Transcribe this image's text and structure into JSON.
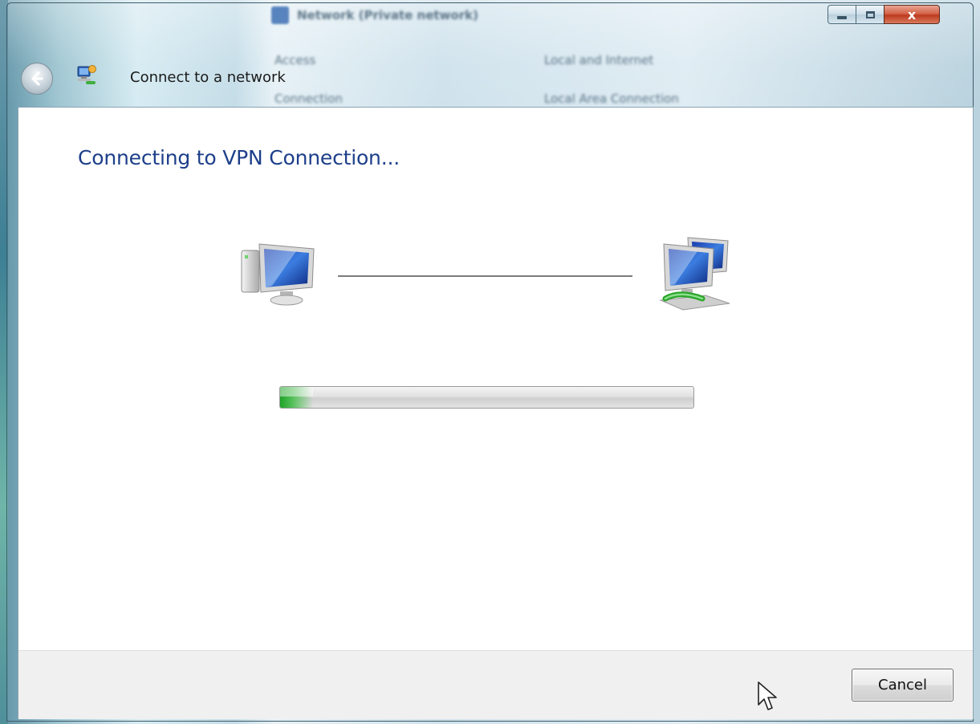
{
  "window": {
    "title": "Connect to a network",
    "caption_buttons": {
      "minimize": "minimize",
      "maximize": "maximize",
      "close": "x"
    }
  },
  "background_window": {
    "title": "Network (Private network)",
    "rows": [
      {
        "label": "Access",
        "value": "Local and Internet"
      },
      {
        "label": "Connection",
        "value": "Local Area Connection"
      }
    ]
  },
  "main": {
    "heading": "Connecting to VPN Connection...",
    "progress_fraction": 0.08
  },
  "footer": {
    "cancel_label": "Cancel"
  },
  "colors": {
    "heading": "#1d3f8a",
    "progress_green": "#1fa32a",
    "close_red": "#c9482b"
  },
  "icons": [
    "back-arrow-icon",
    "network-icon",
    "computer-icon",
    "network-computers-icon",
    "mouse-pointer-icon"
  ]
}
